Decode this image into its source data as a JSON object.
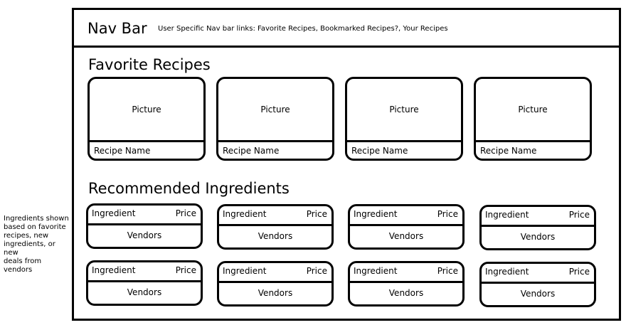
{
  "side_note": "Ingredients shown\nbased on favorite\nrecipes, new\ningredients, or new\ndeals from vendors",
  "navbar": {
    "title": "Nav Bar",
    "links_text": "User Specific Nav bar links: Favorite Recipes, Bookmarked Recipes?, Your Recipes"
  },
  "favorite_recipes": {
    "title": "Favorite Recipes",
    "cards": [
      {
        "picture": "Picture",
        "name": "Recipe Name"
      },
      {
        "picture": "Picture",
        "name": "Recipe Name"
      },
      {
        "picture": "Picture",
        "name": "Recipe Name"
      },
      {
        "picture": "Picture",
        "name": "Recipe Name"
      }
    ]
  },
  "recommended_ingredients": {
    "title": "Recommended Ingredients",
    "rows": [
      [
        {
          "name": "Ingredient",
          "price": "Price",
          "vendors": "Vendors"
        },
        {
          "name": "Ingredient",
          "price": "Price",
          "vendors": "Vendors"
        },
        {
          "name": "Ingredient",
          "price": "Price",
          "vendors": "Vendors"
        },
        {
          "name": "Ingredient",
          "price": "Price",
          "vendors": "Vendors"
        }
      ],
      [
        {
          "name": "Ingredient",
          "price": "Price",
          "vendors": "Vendors"
        },
        {
          "name": "Ingredient",
          "price": "Price",
          "vendors": "Vendors"
        },
        {
          "name": "Ingredient",
          "price": "Price",
          "vendors": "Vendors"
        },
        {
          "name": "Ingredient",
          "price": "Price",
          "vendors": "Vendors"
        }
      ]
    ]
  }
}
